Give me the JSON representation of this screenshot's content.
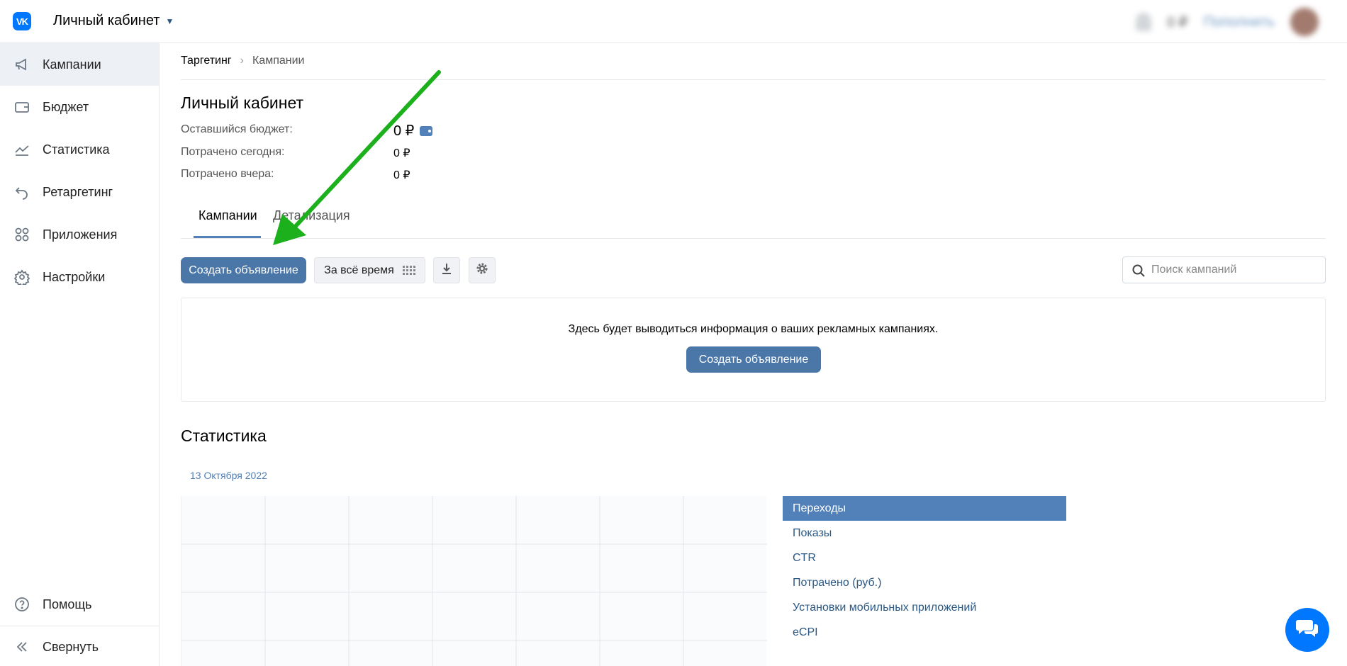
{
  "header": {
    "logo_text": "VK",
    "cabinet_title": "Личный кабинет",
    "balance": "0 ₽",
    "topup_label": "Пополнить"
  },
  "sidebar": {
    "items": [
      {
        "label": "Кампании",
        "icon": "megaphone-icon",
        "active": true
      },
      {
        "label": "Бюджет",
        "icon": "wallet-icon"
      },
      {
        "label": "Статистика",
        "icon": "chart-line-icon"
      },
      {
        "label": "Ретаргетинг",
        "icon": "undo-arrow-icon"
      },
      {
        "label": "Приложения",
        "icon": "apps-grid-icon"
      },
      {
        "label": "Настройки",
        "icon": "gear-icon"
      }
    ],
    "bottom": [
      {
        "label": "Помощь",
        "icon": "question-circle-icon"
      },
      {
        "label": "Свернуть",
        "icon": "double-chevron-left-icon"
      }
    ]
  },
  "breadcrumb": {
    "items": [
      "Таргетинг",
      "Кампании"
    ]
  },
  "page": {
    "title": "Личный кабинет",
    "budget_left_label": "Оставшийся бюджет:",
    "budget_left_value": "0 ₽",
    "spent_today_label": "Потрачено сегодня:",
    "spent_today_value": "0 ₽",
    "spent_yesterday_label": "Потрачено вчера:",
    "spent_yesterday_value": "0 ₽"
  },
  "tabs": [
    {
      "label": "Кампании",
      "active": true
    },
    {
      "label": "Детализация"
    }
  ],
  "toolbar": {
    "create_label": "Создать объявление",
    "period_label": "За всё время",
    "search_placeholder": "Поиск кампаний"
  },
  "empty_state": {
    "text": "Здесь будет выводиться информация о ваших рекламных кампаниях.",
    "button_label": "Создать объявление"
  },
  "statistics": {
    "title": "Статистика",
    "date": "13 Октября 2022",
    "metrics": [
      {
        "label": "Переходы",
        "active": true
      },
      {
        "label": "Показы"
      },
      {
        "label": "CTR"
      },
      {
        "label": "Потрачено (руб.)"
      },
      {
        "label": "Установки мобильных приложений"
      },
      {
        "label": "eCPI"
      }
    ]
  },
  "colors": {
    "accent": "#5181b8",
    "button": "#4a76a8",
    "arrow": "#1db01d",
    "vk_blue": "#0077ff"
  }
}
